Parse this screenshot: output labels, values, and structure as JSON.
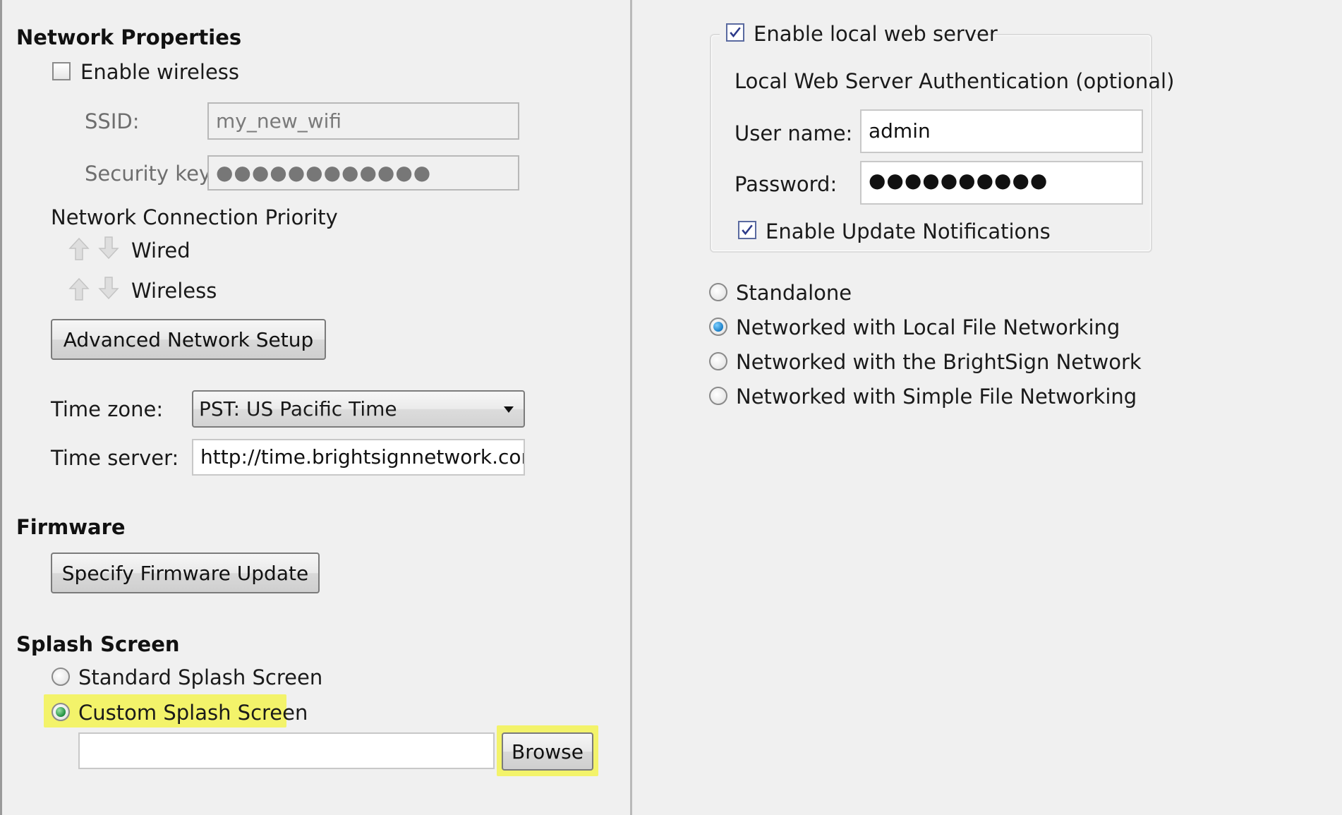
{
  "network": {
    "title": "Network Properties",
    "enable_wireless_label": "Enable wireless",
    "enable_wireless_checked": false,
    "ssid_label": "SSID:",
    "ssid_value": "my_new_wifi",
    "security_key_label": "Security key:",
    "security_key_value": "●●●●●●●●●●●●",
    "priority_title": "Network Connection Priority",
    "priority_items": [
      {
        "label": "Wired",
        "up_icon": "arrow-up-icon",
        "down_icon": "arrow-down-icon"
      },
      {
        "label": "Wireless",
        "up_icon": "arrow-up-icon",
        "down_icon": "arrow-down-icon"
      }
    ],
    "advanced_button": "Advanced Network Setup",
    "timezone_label": "Time zone:",
    "timezone_value": "PST: US Pacific Time",
    "timeserver_label": "Time server:",
    "timeserver_value": "http://time.brightsignnetwork.com"
  },
  "firmware": {
    "title": "Firmware",
    "button": "Specify Firmware Update"
  },
  "splash": {
    "title": "Splash Screen",
    "options": [
      {
        "label": "Standard Splash Screen",
        "selected": false
      },
      {
        "label": "Custom Splash Screen",
        "selected": true
      }
    ],
    "path_value": "",
    "browse_button": "Browse",
    "highlight_color": "#f3f36a"
  },
  "web_server": {
    "enable_label": "Enable local web server",
    "enable_checked": true,
    "auth_title": "Local Web Server Authentication (optional)",
    "username_label": "User name:",
    "username_value": "admin",
    "password_label": "Password:",
    "password_value": "●●●●●●●●●●",
    "update_notifications_label": "Enable Update Notifications",
    "update_notifications_checked": true
  },
  "mode": {
    "options": [
      {
        "label": "Standalone",
        "selected": false
      },
      {
        "label": "Networked with Local File Networking",
        "selected": true
      },
      {
        "label": "Networked with the BrightSign Network",
        "selected": false
      },
      {
        "label": "Networked with Simple File Networking",
        "selected": false
      }
    ]
  }
}
